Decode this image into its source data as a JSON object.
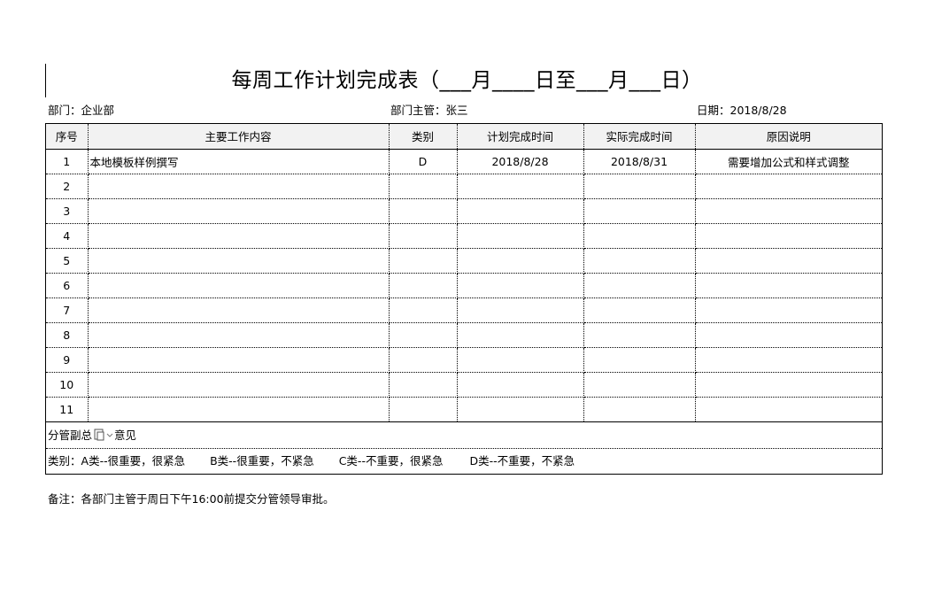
{
  "title": "每周工作计划完成表（___月____日至___月___日）",
  "meta": {
    "department": "部门：企业部",
    "manager": "部门主管：张三",
    "date": "日期：2018/8/28"
  },
  "table": {
    "headers": [
      "序号",
      "主要工作内容",
      "类别",
      "计划完成时间",
      "实际完成时间",
      "原因说明"
    ],
    "rows": [
      [
        "1",
        "本地模板样例撰写",
        "D",
        "2018/8/28",
        "2018/8/31",
        "需要增加公式和样式调整"
      ],
      [
        "2",
        "",
        "",
        "",
        "",
        ""
      ],
      [
        "3",
        "",
        "",
        "",
        "",
        ""
      ],
      [
        "4",
        "",
        "",
        "",
        "",
        ""
      ],
      [
        "5",
        "",
        "",
        "",
        "",
        ""
      ],
      [
        "6",
        "",
        "",
        "",
        "",
        ""
      ],
      [
        "7",
        "",
        "",
        "",
        "",
        ""
      ],
      [
        "8",
        "",
        "",
        "",
        "",
        ""
      ],
      [
        "9",
        "",
        "",
        "",
        "",
        ""
      ],
      [
        "10",
        "",
        "",
        "",
        "",
        ""
      ],
      [
        "11",
        "",
        "",
        "",
        "",
        ""
      ]
    ]
  },
  "opinion": {
    "label_left": "分管副总",
    "label_right": "意见",
    "icon": "paste-options-icon"
  },
  "categories": {
    "prefix": "类别：",
    "a": "A类--很重要，很紧急",
    "b": "B类--很重要，不紧急",
    "c": "C类--不重要，很紧急",
    "d": "D类--不重要，不紧急"
  },
  "note": "备注：各部门主管于周日下午16:00前提交分管领导审批。"
}
